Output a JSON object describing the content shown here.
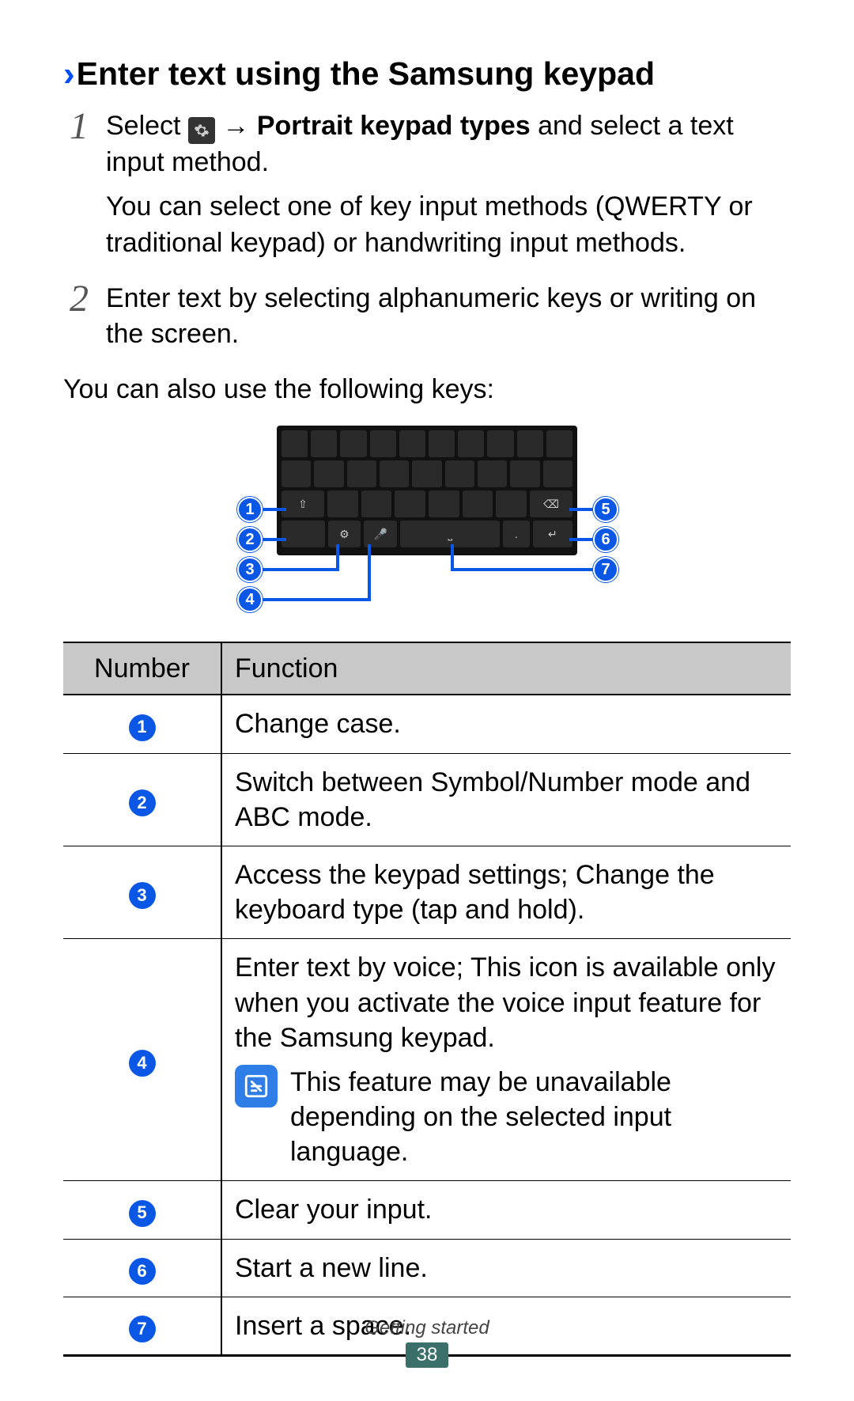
{
  "heading": {
    "title": "Enter text using the Samsung keypad"
  },
  "steps": [
    {
      "num": "1",
      "pre": "Select",
      "arrow": "→",
      "bold": "Portrait keypad types",
      "post": " and select a text input method.",
      "extra": "You can select one of key input methods (QWERTY or traditional keypad) or handwriting input methods."
    },
    {
      "num": "2",
      "text": "Enter text by selecting alphanumeric keys or writing on the screen."
    }
  ],
  "lead": "You can also use the following keys:",
  "callouts": [
    "1",
    "2",
    "3",
    "4",
    "5",
    "6",
    "7"
  ],
  "table": {
    "headers": {
      "col1": "Number",
      "col2": "Function"
    },
    "rows": [
      {
        "num": "1",
        "func": "Change case."
      },
      {
        "num": "2",
        "func": "Switch between Symbol/Number mode and ABC mode."
      },
      {
        "num": "3",
        "func": "Access the keypad settings; Change the keyboard type (tap and hold)."
      },
      {
        "num": "4",
        "func": "Enter text by voice; This icon is available only when you activate the voice input feature for the Samsung keypad.",
        "note": "This feature may be unavailable depending on the selected input language."
      },
      {
        "num": "5",
        "func": "Clear your input."
      },
      {
        "num": "6",
        "func": "Start a new line."
      },
      {
        "num": "7",
        "func": "Insert a space."
      }
    ]
  },
  "footer": {
    "section": "Getting started",
    "page": "38"
  }
}
